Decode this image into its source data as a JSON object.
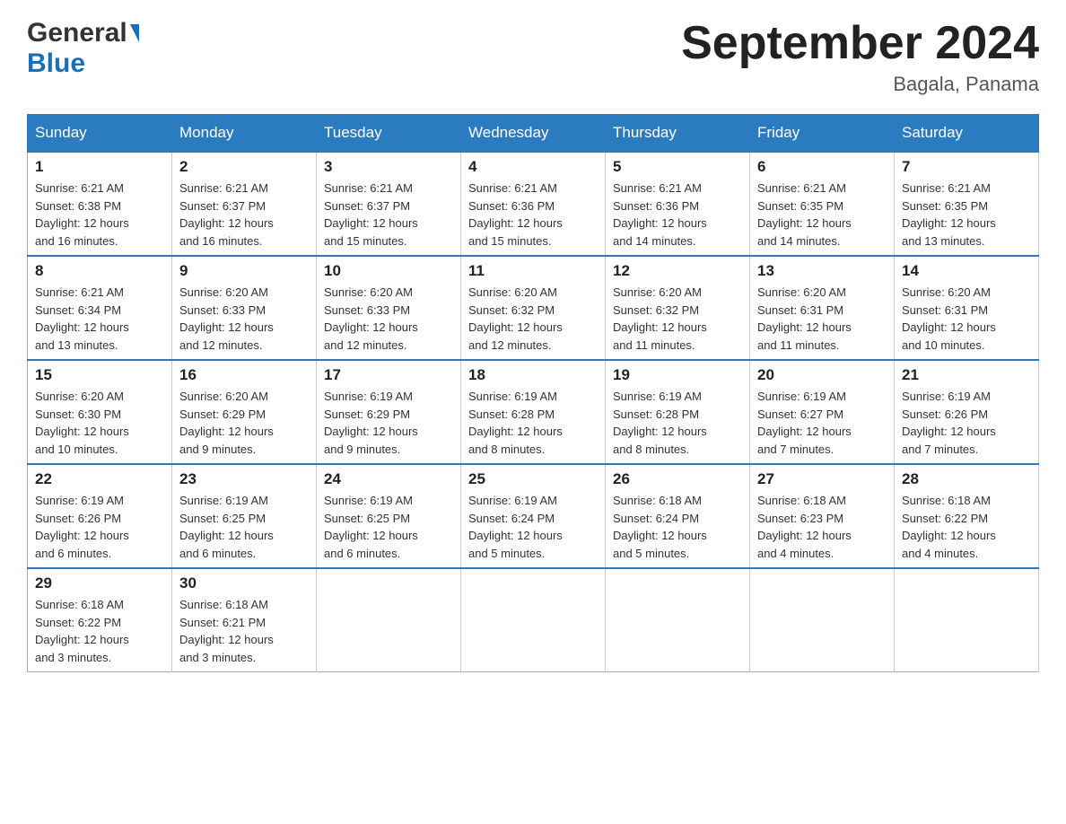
{
  "header": {
    "logo_general": "General",
    "logo_blue": "Blue",
    "month_title": "September 2024",
    "location": "Bagala, Panama"
  },
  "weekdays": [
    "Sunday",
    "Monday",
    "Tuesday",
    "Wednesday",
    "Thursday",
    "Friday",
    "Saturday"
  ],
  "weeks": [
    [
      {
        "day": "1",
        "sunrise": "6:21 AM",
        "sunset": "6:38 PM",
        "daylight": "12 hours and 16 minutes."
      },
      {
        "day": "2",
        "sunrise": "6:21 AM",
        "sunset": "6:37 PM",
        "daylight": "12 hours and 16 minutes."
      },
      {
        "day": "3",
        "sunrise": "6:21 AM",
        "sunset": "6:37 PM",
        "daylight": "12 hours and 15 minutes."
      },
      {
        "day": "4",
        "sunrise": "6:21 AM",
        "sunset": "6:36 PM",
        "daylight": "12 hours and 15 minutes."
      },
      {
        "day": "5",
        "sunrise": "6:21 AM",
        "sunset": "6:36 PM",
        "daylight": "12 hours and 14 minutes."
      },
      {
        "day": "6",
        "sunrise": "6:21 AM",
        "sunset": "6:35 PM",
        "daylight": "12 hours and 14 minutes."
      },
      {
        "day": "7",
        "sunrise": "6:21 AM",
        "sunset": "6:35 PM",
        "daylight": "12 hours and 13 minutes."
      }
    ],
    [
      {
        "day": "8",
        "sunrise": "6:21 AM",
        "sunset": "6:34 PM",
        "daylight": "12 hours and 13 minutes."
      },
      {
        "day": "9",
        "sunrise": "6:20 AM",
        "sunset": "6:33 PM",
        "daylight": "12 hours and 12 minutes."
      },
      {
        "day": "10",
        "sunrise": "6:20 AM",
        "sunset": "6:33 PM",
        "daylight": "12 hours and 12 minutes."
      },
      {
        "day": "11",
        "sunrise": "6:20 AM",
        "sunset": "6:32 PM",
        "daylight": "12 hours and 12 minutes."
      },
      {
        "day": "12",
        "sunrise": "6:20 AM",
        "sunset": "6:32 PM",
        "daylight": "12 hours and 11 minutes."
      },
      {
        "day": "13",
        "sunrise": "6:20 AM",
        "sunset": "6:31 PM",
        "daylight": "12 hours and 11 minutes."
      },
      {
        "day": "14",
        "sunrise": "6:20 AM",
        "sunset": "6:31 PM",
        "daylight": "12 hours and 10 minutes."
      }
    ],
    [
      {
        "day": "15",
        "sunrise": "6:20 AM",
        "sunset": "6:30 PM",
        "daylight": "12 hours and 10 minutes."
      },
      {
        "day": "16",
        "sunrise": "6:20 AM",
        "sunset": "6:29 PM",
        "daylight": "12 hours and 9 minutes."
      },
      {
        "day": "17",
        "sunrise": "6:19 AM",
        "sunset": "6:29 PM",
        "daylight": "12 hours and 9 minutes."
      },
      {
        "day": "18",
        "sunrise": "6:19 AM",
        "sunset": "6:28 PM",
        "daylight": "12 hours and 8 minutes."
      },
      {
        "day": "19",
        "sunrise": "6:19 AM",
        "sunset": "6:28 PM",
        "daylight": "12 hours and 8 minutes."
      },
      {
        "day": "20",
        "sunrise": "6:19 AM",
        "sunset": "6:27 PM",
        "daylight": "12 hours and 7 minutes."
      },
      {
        "day": "21",
        "sunrise": "6:19 AM",
        "sunset": "6:26 PM",
        "daylight": "12 hours and 7 minutes."
      }
    ],
    [
      {
        "day": "22",
        "sunrise": "6:19 AM",
        "sunset": "6:26 PM",
        "daylight": "12 hours and 6 minutes."
      },
      {
        "day": "23",
        "sunrise": "6:19 AM",
        "sunset": "6:25 PM",
        "daylight": "12 hours and 6 minutes."
      },
      {
        "day": "24",
        "sunrise": "6:19 AM",
        "sunset": "6:25 PM",
        "daylight": "12 hours and 6 minutes."
      },
      {
        "day": "25",
        "sunrise": "6:19 AM",
        "sunset": "6:24 PM",
        "daylight": "12 hours and 5 minutes."
      },
      {
        "day": "26",
        "sunrise": "6:18 AM",
        "sunset": "6:24 PM",
        "daylight": "12 hours and 5 minutes."
      },
      {
        "day": "27",
        "sunrise": "6:18 AM",
        "sunset": "6:23 PM",
        "daylight": "12 hours and 4 minutes."
      },
      {
        "day": "28",
        "sunrise": "6:18 AM",
        "sunset": "6:22 PM",
        "daylight": "12 hours and 4 minutes."
      }
    ],
    [
      {
        "day": "29",
        "sunrise": "6:18 AM",
        "sunset": "6:22 PM",
        "daylight": "12 hours and 3 minutes."
      },
      {
        "day": "30",
        "sunrise": "6:18 AM",
        "sunset": "6:21 PM",
        "daylight": "12 hours and 3 minutes."
      },
      null,
      null,
      null,
      null,
      null
    ]
  ],
  "labels": {
    "sunrise": "Sunrise:",
    "sunset": "Sunset:",
    "daylight": "Daylight:"
  }
}
